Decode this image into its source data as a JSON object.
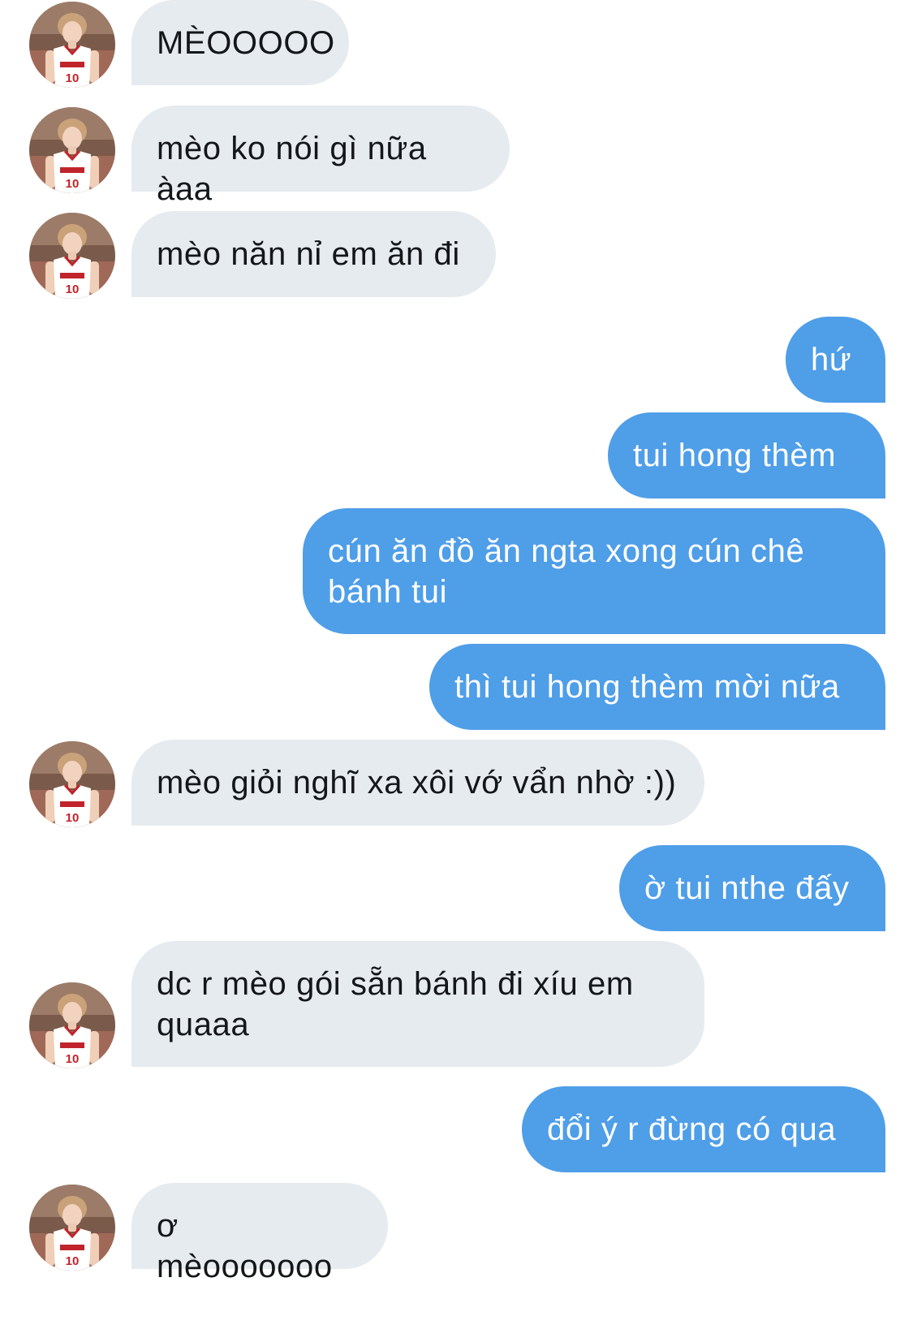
{
  "colors": {
    "incoming_bubble": "#e6ebf0",
    "incoming_text": "#14171a",
    "outgoing_bubble": "#4f9ee8",
    "outgoing_text": "#ffffff"
  },
  "avatar_icon": "user-avatar-icon",
  "messages": [
    {
      "sender": "them",
      "text": "MÈOOOOO"
    },
    {
      "sender": "them",
      "text": "mèo ko nói gì nữa àaa"
    },
    {
      "sender": "them",
      "text": "mèo năn nỉ em ăn đi"
    },
    {
      "sender": "me",
      "text": "hứ"
    },
    {
      "sender": "me",
      "text": "tui hong thèm"
    },
    {
      "sender": "me",
      "text": "cún ăn đồ ăn ngta xong cún chê bánh tui"
    },
    {
      "sender": "me",
      "text": "thì tui hong thèm mời nữa"
    },
    {
      "sender": "them",
      "text": "mèo giỏi nghĩ xa xôi vớ vẩn nhờ :))"
    },
    {
      "sender": "me",
      "text": "ờ tui nthe đấy"
    },
    {
      "sender": "them",
      "text": "dc r mèo gói sẵn bánh đi xíu em quaaa"
    },
    {
      "sender": "me",
      "text": "đổi ý r đừng có qua"
    },
    {
      "sender": "them",
      "text": "ơ mèooooooo"
    }
  ]
}
